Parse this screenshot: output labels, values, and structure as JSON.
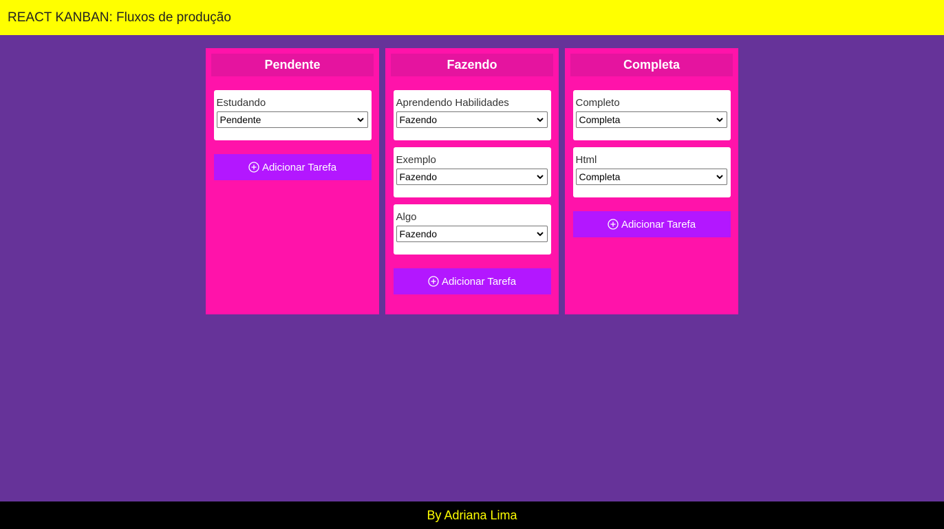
{
  "header": {
    "title": "REACT KANBAN: Fluxos de produção"
  },
  "colors": {
    "header_bg": "#ffff00",
    "page_bg": "#663399",
    "column_bg": "#ff13aa",
    "column_title_bg": "#e5149f",
    "button_bg": "#b317ff",
    "footer_bg": "#000000",
    "footer_text": "#ffff00"
  },
  "columns": [
    {
      "title": "Pendente",
      "cards": [
        {
          "title": "Estudando",
          "status": "Pendente"
        }
      ],
      "add_label": "Adicionar Tarefa"
    },
    {
      "title": "Fazendo",
      "cards": [
        {
          "title": "Aprendendo Habilidades",
          "status": "Fazendo"
        },
        {
          "title": "Exemplo",
          "status": "Fazendo"
        },
        {
          "title": "Algo",
          "status": "Fazendo"
        }
      ],
      "add_label": "Adicionar Tarefa"
    },
    {
      "title": "Completa",
      "cards": [
        {
          "title": "Completo",
          "status": "Completa"
        },
        {
          "title": "Html",
          "status": "Completa"
        }
      ],
      "add_label": "Adicionar Tarefa"
    }
  ],
  "footer": {
    "text": "By Adriana Lima"
  }
}
